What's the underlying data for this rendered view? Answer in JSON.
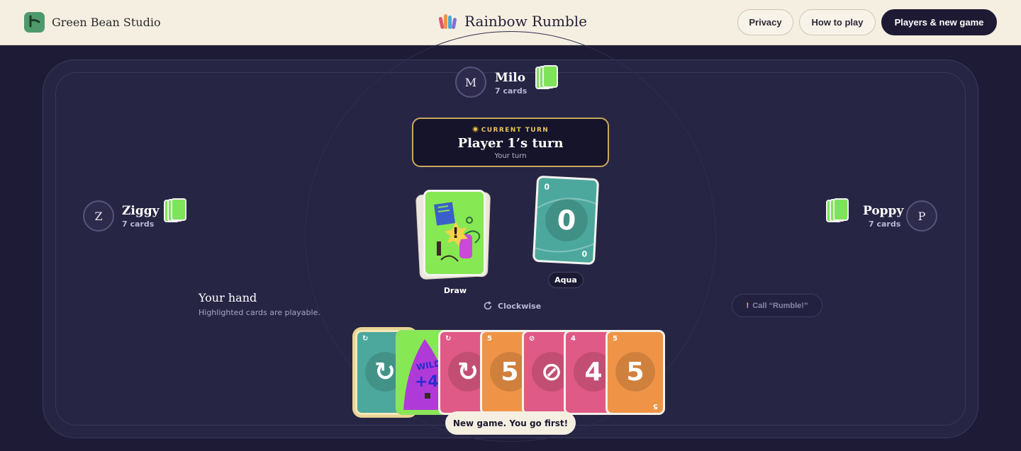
{
  "header": {
    "studio_name": "Green Bean Studio",
    "app_title": "Rainbow Rumble",
    "buttons": {
      "privacy": "Privacy",
      "how_to_play": "How to play",
      "players_new_game": "Players & new game"
    }
  },
  "players": {
    "top": {
      "initial": "M",
      "name": "Milo",
      "count": "7 cards"
    },
    "left": {
      "initial": "Z",
      "name": "Ziggy",
      "count": "7 cards"
    },
    "right": {
      "initial": "P",
      "name": "Poppy",
      "count": "7 cards"
    }
  },
  "turn": {
    "tag": "CURRENT TURN",
    "title": "Player 1’s turn",
    "subtitle": "Your turn"
  },
  "draw_pile": {
    "label": "Draw",
    "top_symbol": "!"
  },
  "discard": {
    "value": "0",
    "corner": "0",
    "color_label": "Aqua"
  },
  "hand": {
    "title": "Your hand",
    "hint": "Highlighted cards are playable.",
    "direction": "Clockwise",
    "call_button": "Call “Rumble!”",
    "cards": [
      {
        "color": "teal",
        "symbol": "↻",
        "corner": "↻",
        "selected": true
      },
      {
        "color": "wild",
        "symbol": "+4",
        "corner": "WILD",
        "selected": false
      },
      {
        "color": "pink",
        "symbol": "↻",
        "corner": "↻",
        "selected": false
      },
      {
        "color": "orange",
        "symbol": "5",
        "corner": "5",
        "selected": false
      },
      {
        "color": "pink",
        "symbol": "⊘",
        "corner": "⊘",
        "selected": false
      },
      {
        "color": "pink",
        "symbol": "4",
        "corner": "4",
        "selected": false
      },
      {
        "color": "orange",
        "symbol": "5",
        "corner": "5",
        "selected": false
      }
    ]
  },
  "toast": "New game. You go first!",
  "colors": {
    "background": "#1d1b36",
    "table": "#272544",
    "header": "#f5efe2",
    "accent_gold": "#c9a85c",
    "card_green": "#86e853",
    "card_teal": "#4ca89d",
    "card_pink": "#df5a86",
    "card_orange": "#ef9447"
  }
}
